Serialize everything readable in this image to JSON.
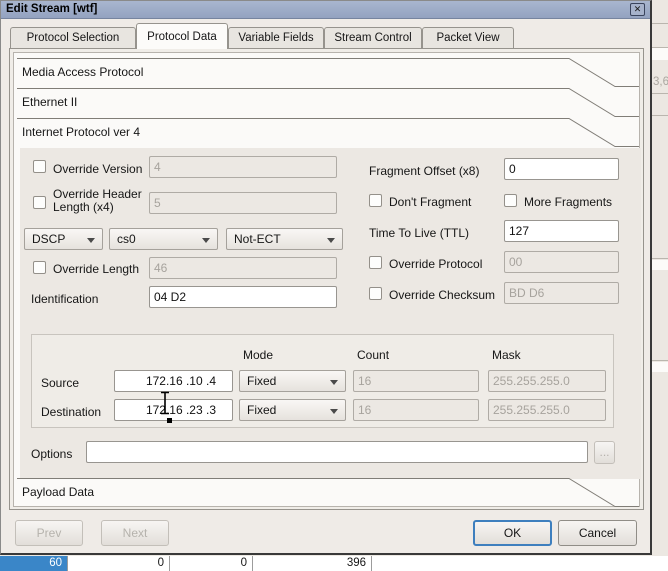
{
  "window": {
    "title": "Edit Stream [wtf]",
    "close": "✕"
  },
  "tabs": [
    {
      "label": "Protocol Selection"
    },
    {
      "label": "Protocol Data"
    },
    {
      "label": "Variable Fields"
    },
    {
      "label": "Stream Control"
    },
    {
      "label": "Packet View"
    }
  ],
  "sections": {
    "media_access": "Media Access Protocol",
    "ethernet2": "Ethernet II",
    "ipv4": "Internet Protocol ver 4",
    "payload": "Payload Data"
  },
  "ipv4": {
    "override_version_label": "Override Version",
    "version_value": "4",
    "override_header_length_label": "Override Header Length (x4)",
    "header_length_value": "5",
    "dscp_label": "DSCP",
    "dscp_value": "cs0",
    "ecn_value": "Not-ECT",
    "override_length_label": "Override Length",
    "length_value": "46",
    "identification_label": "Identification",
    "identification_value": "04 D2",
    "fragment_offset_label": "Fragment Offset (x8)",
    "fragment_offset_value": "0",
    "dont_fragment_label": "Don't Fragment",
    "more_fragments_label": "More Fragments",
    "ttl_label": "Time To Live (TTL)",
    "ttl_value": "127",
    "override_protocol_label": "Override Protocol",
    "protocol_value": "00",
    "override_checksum_label": "Override Checksum",
    "checksum_value": "BD D6",
    "table": {
      "mode_header": "Mode",
      "count_header": "Count",
      "mask_header": "Mask",
      "rows": [
        {
          "label": "Source",
          "address": "172.16 .10 .4",
          "mode": "Fixed",
          "count": "16",
          "mask": "255.255.255.0"
        },
        {
          "label": "Destination",
          "address": "172.16 .23 .3",
          "mode": "Fixed",
          "count": "16",
          "mask": "255.255.255.0"
        }
      ]
    },
    "options_label": "Options",
    "options_value": "",
    "browse_label": "..."
  },
  "footer": {
    "prev": "Prev",
    "next": "Next",
    "ok": "OK",
    "cancel": "Cancel"
  },
  "background": {
    "clipped_value": "3,6",
    "stats_row": [
      "60",
      "0",
      "0",
      "396"
    ]
  },
  "colors": {
    "titlebar": "#9FACC8",
    "selection_blue": "#3A86C8",
    "dialog_bg": "#EFEBE7",
    "panel_bg": "#ECE8E3"
  }
}
